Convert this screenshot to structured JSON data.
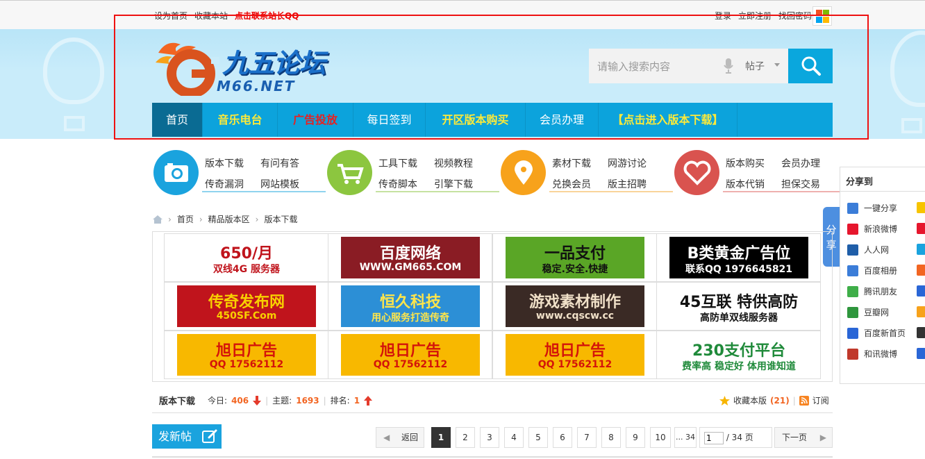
{
  "topbar": {
    "left_links": [
      "设为首页",
      "收藏本站"
    ],
    "contact_link": "点击联系站长QQ",
    "right_links": [
      "登录",
      "立即注册",
      "找回密码"
    ]
  },
  "logo": {
    "brand": "九五论坛",
    "sub": "M66.NET"
  },
  "search": {
    "placeholder": "请输入搜索内容",
    "scope": "帖子"
  },
  "nav": [
    {
      "label": "首页",
      "style": "active"
    },
    {
      "label": "音乐电台",
      "style": "yellow"
    },
    {
      "label": "广告投放",
      "style": "red"
    },
    {
      "label": "每日签到",
      "style": "normal"
    },
    {
      "label": "开区版本购买",
      "style": "yellow"
    },
    {
      "label": "会员办理",
      "style": "normal"
    },
    {
      "label": "【点击进入版本下载】",
      "style": "yellow"
    }
  ],
  "quick_links": [
    {
      "icon": "camera-icon",
      "color": "#1aa3de",
      "links": [
        "版本下载",
        "有问有答",
        "传奇漏洞",
        "网站模板"
      ]
    },
    {
      "icon": "cart-icon",
      "color": "#8cc63f",
      "links": [
        "工具下载",
        "视频教程",
        "传奇脚本",
        "引擎下载"
      ]
    },
    {
      "icon": "location-icon",
      "color": "#f7a21b",
      "links": [
        "素材下载",
        "网游讨论",
        "兑换会员",
        "版主招聘"
      ]
    },
    {
      "icon": "heart-icon",
      "color": "#d9534f",
      "links": [
        "版本购买",
        "会员办理",
        "版本代销",
        "担保交易"
      ]
    }
  ],
  "share": {
    "title": "分享到",
    "tab": "分享",
    "items": [
      {
        "label": "一键分享",
        "color": "#3b7dd8"
      },
      {
        "label": "新浪微博",
        "color": "#e6162d"
      },
      {
        "label": "人人网",
        "color": "#1f5ea8"
      },
      {
        "label": "百度相册",
        "color": "#3b7dd8"
      },
      {
        "label": "腾讯朋友",
        "color": "#3fae49"
      },
      {
        "label": "豆瓣网",
        "color": "#2e963d"
      },
      {
        "label": "百度新首页",
        "color": "#2a66d6"
      },
      {
        "label": "和讯微博",
        "color": "#c0392b"
      }
    ]
  },
  "breadcrumb": [
    "首页",
    "精品版本区",
    "版本下载"
  ],
  "ads": [
    {
      "lines": [
        "650/月",
        "双线4G 服务器"
      ],
      "bg": "#ffffff",
      "fg": "#c0141c"
    },
    {
      "lines": [
        "百度网络",
        "WWW.GM665.COM"
      ],
      "bg": "#8a1c24",
      "fg": "#ffffff"
    },
    {
      "lines": [
        "一品支付",
        "稳定.安全.快捷"
      ],
      "bg": "#5aa626",
      "fg": "#111111"
    },
    {
      "lines": [
        "B类黄金广告位",
        "联系QQ 1976645821"
      ],
      "bg": "#000000",
      "fg": "#ffffff"
    },
    {
      "lines": [
        "传奇发布网",
        "450SF.Com"
      ],
      "bg": "#c0141c",
      "fg": "#f8d000"
    },
    {
      "lines": [
        "恒久科技",
        "用心服务打造传奇"
      ],
      "bg": "#2c8fd6",
      "fg": "#ffe54a"
    },
    {
      "lines": [
        "游戏素材制作",
        "www.cqscw.cc"
      ],
      "bg": "#3a2a25",
      "fg": "#f0e0c8"
    },
    {
      "lines": [
        "45互联 特供高防",
        "高防单双线服务器"
      ],
      "bg": "#ffffff",
      "fg": "#111111"
    },
    {
      "lines": [
        "旭日广告",
        "QQ 17562112"
      ],
      "bg": "#f8b800",
      "fg": "#d4140a"
    },
    {
      "lines": [
        "旭日广告",
        "QQ 17562112"
      ],
      "bg": "#f8b800",
      "fg": "#d4140a"
    },
    {
      "lines": [
        "旭日广告",
        "QQ 17562112"
      ],
      "bg": "#f8b800",
      "fg": "#d4140a"
    },
    {
      "lines": [
        "230支付平台",
        "费率高 稳定好 体用谁知道"
      ],
      "bg": "#ffffff",
      "fg": "#1f8a3a"
    }
  ],
  "forum": {
    "name": "版本下载",
    "today_label": "今日:",
    "today": "406",
    "topics_label": "主题:",
    "topics": "1693",
    "rank_label": "排名:",
    "rank": "1",
    "fav_label": "收藏本版",
    "fav_count": "(21)",
    "subscribe": "订阅"
  },
  "newpost": "发新帖",
  "pager": {
    "back": "返回",
    "pages": [
      "1",
      "2",
      "3",
      "4",
      "5",
      "6",
      "7",
      "8",
      "9",
      "10"
    ],
    "current": "1",
    "last": "... 34",
    "input_value": "1",
    "total": "/ 34 页",
    "next": "下一页"
  }
}
